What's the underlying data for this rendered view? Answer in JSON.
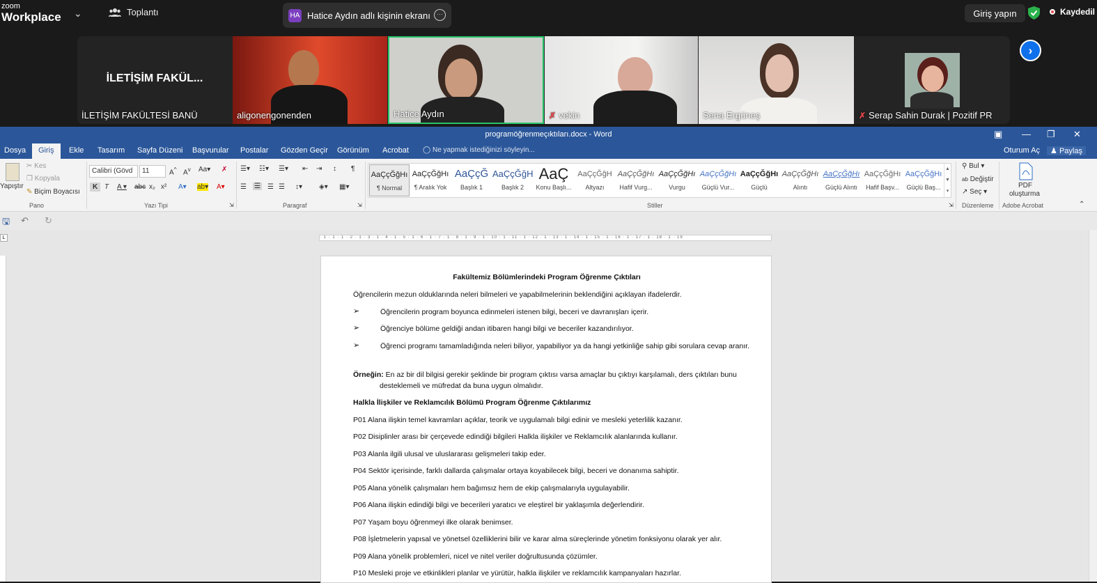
{
  "zoom": {
    "logo_line1": "zoom",
    "logo_line2": "Workplace",
    "meeting_label": "Toplantı",
    "share_badge": "HA",
    "share_title": "Hatice Aydın adlı kişinin ekranı",
    "login_label": "Giriş yapın",
    "recording_label": "Kaydedil",
    "colors": {
      "bar": "#1a1a1a",
      "active_speaker": "#27c46a",
      "next_button": "#0e71eb",
      "recording": "#e5484d"
    }
  },
  "participants": [
    {
      "big_label": "İLETİŞİM FAKÜL...",
      "name": "İLETİŞİM FAKÜLTESİ BANÜ",
      "muted": false
    },
    {
      "name": "aligonengonenden",
      "muted": false
    },
    {
      "name": "Hatice Aydın",
      "muted": false,
      "active": true
    },
    {
      "name": "vekin",
      "muted": true
    },
    {
      "name": "Sena Ergüneş",
      "muted": false
    },
    {
      "name": "Serap Sahin Durak | Pozitif PR",
      "muted": true
    }
  ],
  "word": {
    "window_title": "programöğrenmeçıktıları.docx - Word",
    "tabs": [
      "Dosya",
      "Giriş",
      "Ekle",
      "Tasarım",
      "Sayfa Düzeni",
      "Başvurular",
      "Postalar",
      "Gözden Geçir",
      "Görünüm",
      "Acrobat"
    ],
    "active_tab": "Giriş",
    "tell_me": "Ne yapmak istediğinizi söyleyin...",
    "sign_in": "Oturum Aç",
    "share": "Paylaş",
    "clipboard": {
      "paste": "Yapıştır",
      "cut": "Kes",
      "copy": "Kopyala",
      "format_painter": "Biçim Boyacısı"
    },
    "font": {
      "name": "Calibri (Gövd",
      "size": "11"
    },
    "group_labels": {
      "clipboard": "Pano",
      "font": "Yazı Tipi",
      "paragraph": "Paragraf",
      "styles": "Stiller",
      "editing": "Düzenleme",
      "acrobat": "Adobe Acrobat"
    },
    "styles": [
      {
        "preview": "AaÇçĞğHı",
        "name": "¶ Normal"
      },
      {
        "preview": "AaÇçĞğHı",
        "name": "¶ Aralık Yok"
      },
      {
        "preview": "AaÇçĞ",
        "name": "Başlık 1"
      },
      {
        "preview": "AaÇçĞğH",
        "name": "Başlık 2"
      },
      {
        "preview": "AaÇ",
        "name": "Konu Başlı..."
      },
      {
        "preview": "AaÇçĞğH",
        "name": "Altyazı"
      },
      {
        "preview": "AaÇçĞğHı",
        "name": "Hafif Vurg..."
      },
      {
        "preview": "AaÇçĞğHı",
        "name": "Vurgu"
      },
      {
        "preview": "AaÇçĞğHı",
        "name": "Güçlü Vur..."
      },
      {
        "preview": "AaÇçĞğHı",
        "name": "Güçlü"
      },
      {
        "preview": "AaÇçĞğHı",
        "name": "Alıntı"
      },
      {
        "preview": "AaÇçĞğHı",
        "name": "Güçlü Alıntı"
      },
      {
        "preview": "AaÇçĞğHı",
        "name": "Hafif Başv..."
      },
      {
        "preview": "AaÇçĞğHı",
        "name": "Güçlü Baş..."
      }
    ],
    "editing": {
      "find": "Bul",
      "replace": "Değiştir",
      "select": "Seç"
    },
    "acrobat": {
      "pdf_line1": "PDF",
      "pdf_line2": "oluşturma"
    },
    "ruler": "· 1 · 1 · 1 · 2 · 1 · 3 · 1 · 4 · 1 · 5 · 1 · 6 · 1 · 7 · 1 · 8 · 1 · 9 · 1 · 10 · 1 · 11 · 1 · 12 · 1 · 13 · 1 · 14 · 1 · 15 · 1 · 16 · 1 · 17 · 1 · 18 · 1 · 19"
  },
  "document": {
    "title": "Fakültemiz Bölümlerindeki Program Öğrenme Çıktıları",
    "intro": "Öğrencilerin mezun olduklarında neleri bilmeleri ve yapabilmelerinin beklendiğini açıklayan ifadelerdir.",
    "bullet_symbol": "➢",
    "bullets": [
      "Öğrencilerin program boyunca edinmeleri istenen bilgi, beceri ve davranışları içerir.",
      "Öğrenciye bölüme geldiği andan itibaren hangi bilgi ve beceriler kazandırılıyor.",
      "Öğrenci programı tamamladığında neleri biliyor, yapabiliyor ya da hangi yetkinliğe sahip gibi sorulara cevap aranır."
    ],
    "example_label": "Örneğin:",
    "example_text": "En az bir dil bilgisi gerekir şeklinde bir program çıktısı varsa amaçlar bu çıktıyı karşılamalı, ders çıktıları bunu desteklemeli ve müfredat da buna uygun olmalıdır.",
    "section_title": "Halkla İlişkiler ve Reklamcılık Bölümü Program Öğrenme Çıktılarımız",
    "outcomes": [
      "P01 Alana ilişkin temel kavramları açıklar, teorik ve uygulamalı bilgi edinir ve mesleki yeterlilik kazanır.",
      "P02 Disiplinler arası bir çerçevede edindiği bilgileri Halkla ilişkiler ve Reklamcılık alanlarında kullanır.",
      "P03 Alanla ilgili ulusal ve uluslararası gelişmeleri takip eder.",
      "P04 Sektör içerisinde, farklı dallarda çalışmalar ortaya koyabilecek bilgi, beceri ve donanıma sahiptir.",
      "P05 Alana yönelik çalışmaları hem bağımsız hem de ekip çalışmalarıyla uygulayabilir.",
      "P06 Alana ilişkin edindiği bilgi ve becerileri yaratıcı ve eleştirel bir yaklaşımla değerlendirir.",
      "P07 Yaşam boyu öğrenmeyi ilke olarak benimser.",
      "P08 İşletmelerin yapısal ve yönetsel özelliklerini bilir ve karar alma süreçlerinde yönetim fonksiyonu olarak yer alır.",
      "P09 Alana yönelik problemleri, nicel ve nitel veriler doğrultusunda çözümler.",
      "P10 Mesleki proje ve etkinlikleri planlar ve yürütür, halkla ilişkiler ve reklamcılık kampanyaları hazırlar."
    ]
  }
}
